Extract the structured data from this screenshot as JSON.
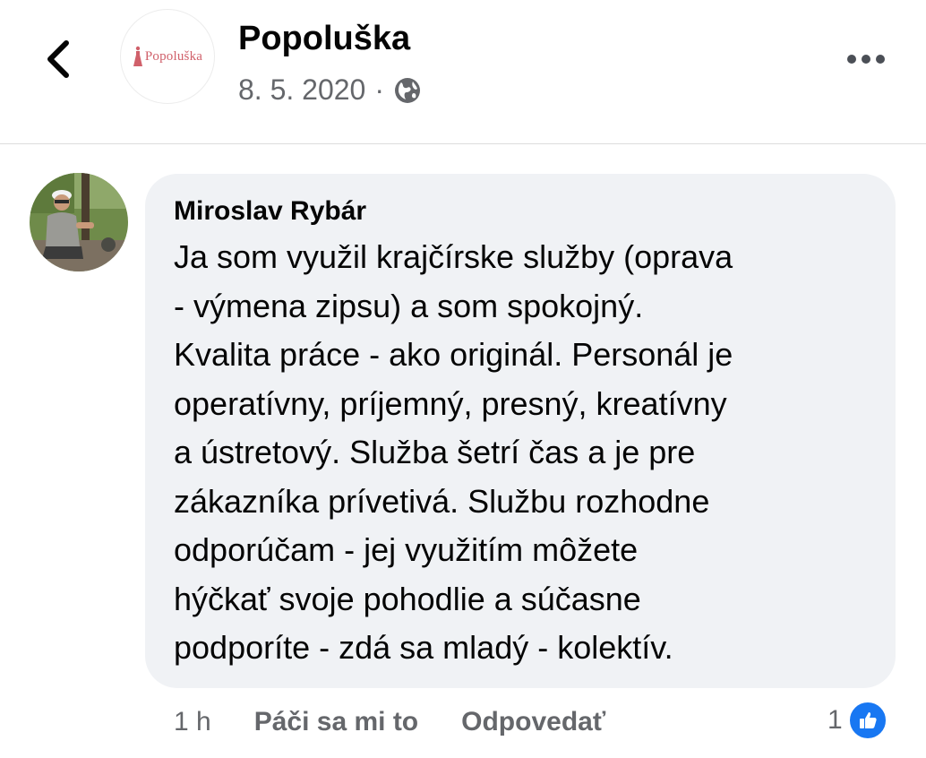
{
  "header": {
    "page_name": "Popoluška",
    "logo_text": "Popoluška",
    "date": "8. 5. 2020",
    "separator": "·",
    "privacy_icon": "globe-icon",
    "back_icon": "chevron-left-icon",
    "more_icon": "more-horizontal-icon"
  },
  "comment": {
    "author": "Miroslav Rybár",
    "text": "Ja som využil krajčírske služby (oprava\n- výmena zipsu) a som spokojný.\nKvalita práce - ako originál. Personál je\noperatívny, príjemný, presný, kreatívny\na ústretový. Služba šetrí čas a je pre\nzákazníka prívetivá. Službu rozhodne\nodporúčam - jej využitím môžete\nhýčkať svoje pohodlie a súčasne\npodporíte  - zdá sa mladý - kolektív.",
    "time": "1 h",
    "like_label": "Páči sa mi to",
    "reply_label": "Odpovedať",
    "reaction_count": "1",
    "reaction_icon": "thumbs-up-icon"
  },
  "colors": {
    "bubble": "#f0f2f5",
    "secondary_text": "#65676b",
    "like_blue": "#1877f2",
    "logo_pink": "#d0606a"
  }
}
